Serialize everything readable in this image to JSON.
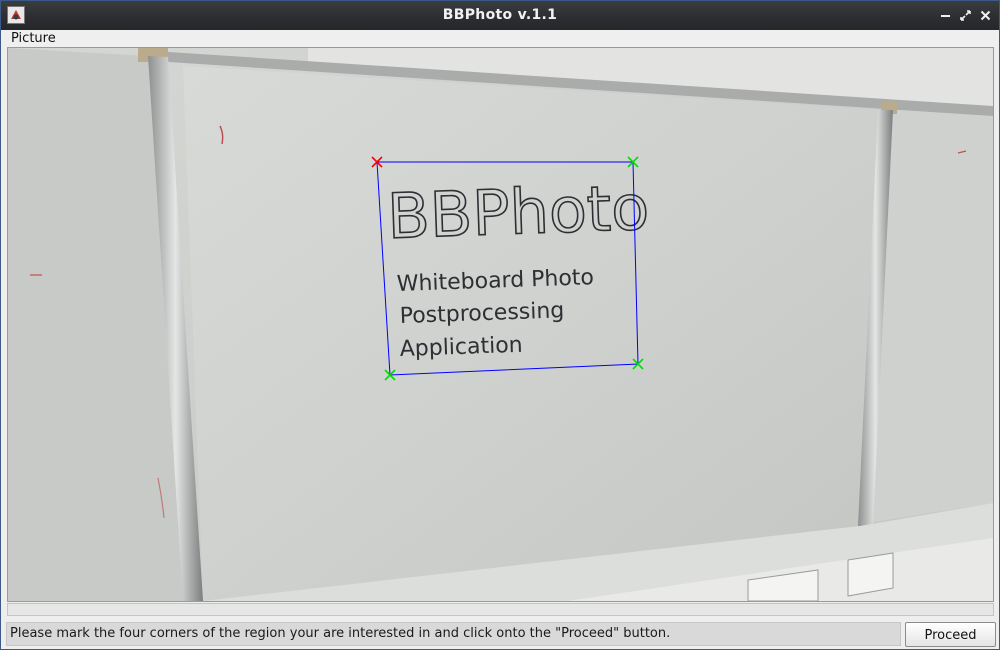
{
  "window": {
    "title": "BBPhoto v.1.1",
    "icons": [
      "app-icon",
      "minimize-icon",
      "maximize-icon",
      "close-icon"
    ]
  },
  "menubar": {
    "items": [
      {
        "label": "Picture"
      }
    ]
  },
  "canvas": {
    "board_text": {
      "title": "BBPhoto",
      "lines": [
        "Whiteboard Photo",
        "Postprocessing",
        "Application"
      ]
    },
    "corner_colors": {
      "active": "#ff0000",
      "placed": "#00dd00",
      "outline": "#0000ff"
    }
  },
  "status": {
    "message": "Please mark the four corners of the region your are interested in and click onto the \"Proceed\" button."
  },
  "actions": {
    "proceed_label": "Proceed"
  }
}
